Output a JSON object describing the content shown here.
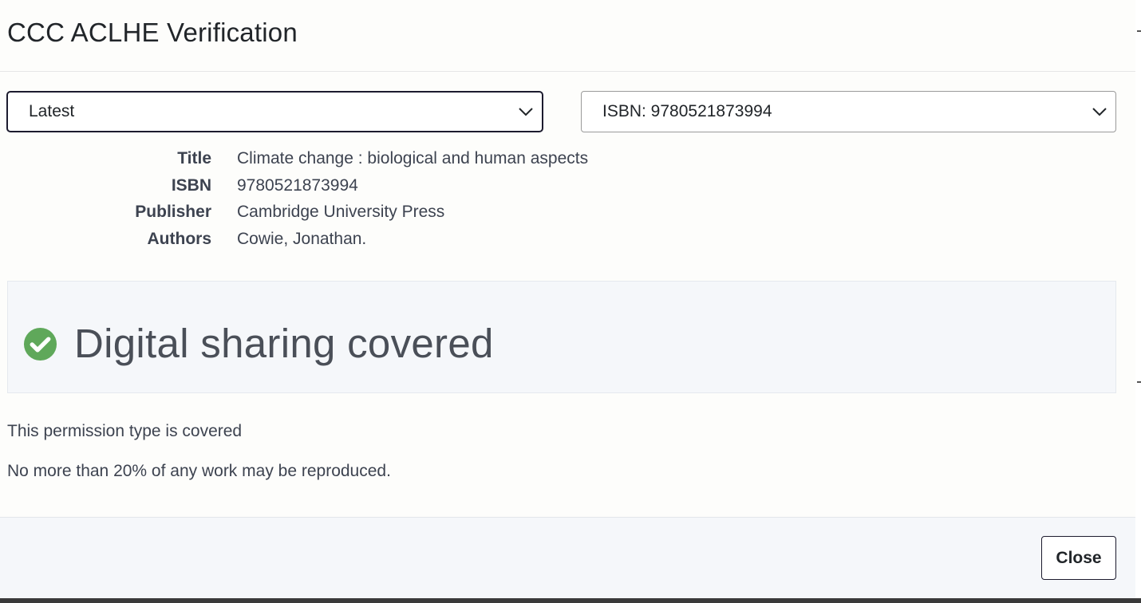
{
  "modal": {
    "title": "CCC ACLHE Verification"
  },
  "selectors": {
    "version": {
      "selected": "Latest"
    },
    "isbn": {
      "selected": "ISBN: 9780521873994"
    }
  },
  "details": [
    {
      "label": "Title",
      "value": "Climate change : biological and human aspects"
    },
    {
      "label": "ISBN",
      "value": "9780521873994"
    },
    {
      "label": "Publisher",
      "value": "Cambridge University Press"
    },
    {
      "label": "Authors",
      "value": "Cowie, Jonathan."
    }
  ],
  "status": {
    "text": "Digital sharing covered",
    "icon": "check-circle-icon",
    "color": "#5fa85a"
  },
  "notes": {
    "permission": "This permission type is covered",
    "limit": "No more than 20% of any work may be reproduced."
  },
  "footer": {
    "close_label": "Close"
  }
}
